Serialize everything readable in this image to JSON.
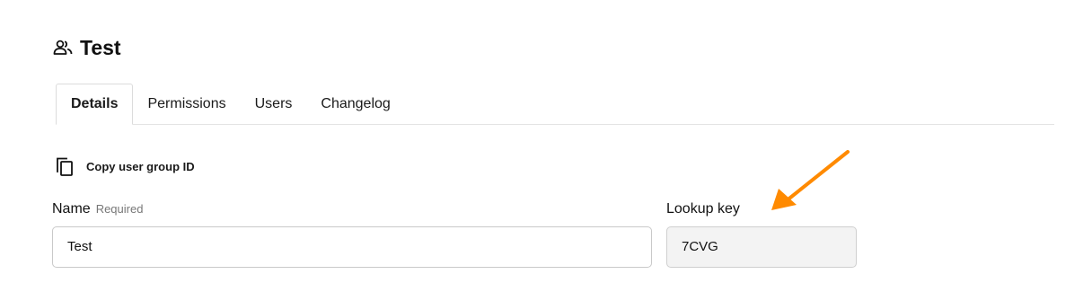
{
  "page": {
    "title": "Test",
    "title_icon": "user-group-icon"
  },
  "tabs": [
    {
      "label": "Details",
      "active": true
    },
    {
      "label": "Permissions",
      "active": false
    },
    {
      "label": "Users",
      "active": false
    },
    {
      "label": "Changelog",
      "active": false
    }
  ],
  "copy_action": {
    "label": "Copy user group ID",
    "icon": "copy-icon"
  },
  "name_field": {
    "label": "Name",
    "required_text": "Required",
    "value": "Test"
  },
  "lookup_field": {
    "label": "Lookup key",
    "value": "7CVG"
  },
  "annotation": {
    "arrow_color": "#ff8a00"
  }
}
